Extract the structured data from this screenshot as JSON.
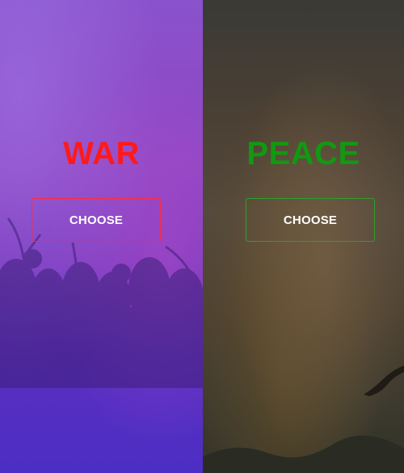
{
  "war": {
    "title": "WAR",
    "button_label": "CHOOSE",
    "title_color": "#ff1a1a",
    "border_color": "#ff2a3a",
    "background": "purple-battle-scene"
  },
  "peace": {
    "title": "PEACE",
    "button_label": "CHOOSE",
    "title_color": "#119911",
    "border_color": "#2ea02e",
    "background": "dusk-sky-with-bird"
  }
}
